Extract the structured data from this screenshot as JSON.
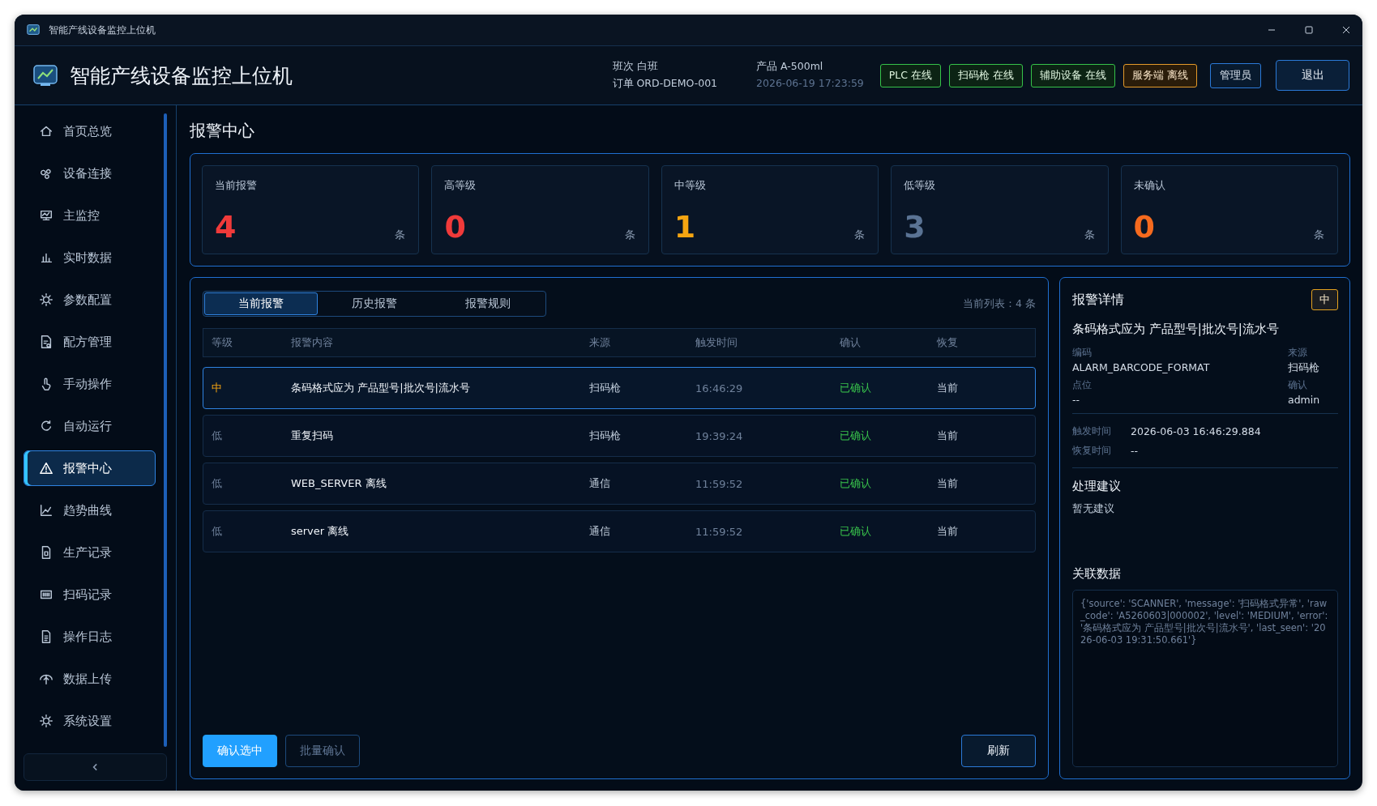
{
  "window": {
    "title": "智能产线设备监控上位机"
  },
  "header": {
    "title": "智能产线设备监控上位机",
    "info": [
      {
        "label": "班次",
        "value": "白班"
      },
      {
        "label": "订单",
        "value": "ORD-DEMO-001"
      },
      {
        "label": "产品",
        "value": "A-500ml"
      },
      {
        "value": "2026-06-19 17:23:59"
      }
    ],
    "statuses": [
      {
        "label": "PLC 在线",
        "online": true
      },
      {
        "label": "扫码枪 在线",
        "online": true
      },
      {
        "label": "辅助设备 在线",
        "online": true
      },
      {
        "label": "服务端 离线",
        "online": false
      }
    ],
    "user": "管理员",
    "logout": "退出"
  },
  "sidebar": {
    "items": [
      {
        "label": "首页总览",
        "selected": false
      },
      {
        "label": "设备连接",
        "selected": false
      },
      {
        "label": "主监控",
        "selected": false
      },
      {
        "label": "实时数据",
        "selected": false
      },
      {
        "label": "参数配置",
        "selected": false
      },
      {
        "label": "配方管理",
        "selected": false
      },
      {
        "label": "手动操作",
        "selected": false
      },
      {
        "label": "自动运行",
        "selected": false
      },
      {
        "label": "报警中心",
        "selected": true
      },
      {
        "label": "趋势曲线",
        "selected": false
      },
      {
        "label": "生产记录",
        "selected": false
      },
      {
        "label": "扫码记录",
        "selected": false
      },
      {
        "label": "操作日志",
        "selected": false
      },
      {
        "label": "数据上传",
        "selected": false
      },
      {
        "label": "系统设置",
        "selected": false
      }
    ]
  },
  "page_title": "报警中心",
  "stats": [
    {
      "label": "当前报警",
      "value": "4",
      "unit": "条",
      "color": "#f03a3a"
    },
    {
      "label": "高等级",
      "value": "0",
      "unit": "条",
      "color": "#f03a3a"
    },
    {
      "label": "中等级",
      "value": "1",
      "unit": "条",
      "color": "#f5a511"
    },
    {
      "label": "低等级",
      "value": "3",
      "unit": "条",
      "color": "#5a7394"
    },
    {
      "label": "未确认",
      "value": "0",
      "unit": "条",
      "color": "#f56a1e"
    }
  ],
  "tabs": [
    {
      "label": "当前报警",
      "selected": true
    },
    {
      "label": "历史报警",
      "selected": false
    },
    {
      "label": "报警规则",
      "selected": false
    }
  ],
  "list_count": "当前列表：4 条",
  "table": {
    "columns": [
      "等级",
      "报警内容",
      "来源",
      "触发时间",
      "确认",
      "恢复"
    ],
    "rows": [
      {
        "level": "中",
        "kind": "medium",
        "message": "条码格式应为 产品型号|批次号|流水号",
        "source": "扫码枪",
        "time": "16:46:29",
        "confirm": "已确认",
        "confirmed": true,
        "recover": "当前",
        "selected": true
      },
      {
        "level": "低",
        "kind": "low",
        "message": "重复扫码",
        "source": "扫码枪",
        "time": "19:39:24",
        "confirm": "已确认",
        "confirmed": true,
        "recover": "当前",
        "selected": false
      },
      {
        "level": "低",
        "kind": "low",
        "message": "WEB_SERVER 离线",
        "source": "通信",
        "time": "11:59:52",
        "confirm": "已确认",
        "confirmed": true,
        "recover": "当前",
        "selected": false
      },
      {
        "level": "低",
        "kind": "low",
        "message": "server 离线",
        "source": "通信",
        "time": "11:59:52",
        "confirm": "已确认",
        "confirmed": true,
        "recover": "当前",
        "selected": false
      }
    ]
  },
  "actions": [
    {
      "label": "确认选中",
      "kind": "primary",
      "disabled": false
    },
    {
      "label": "批量确认",
      "kind": "secondary",
      "disabled": true
    }
  ],
  "refresh": "刷新",
  "detail": {
    "title": "报警详情",
    "badge": "中",
    "message": "条码格式应为 产品型号|批次号|流水号",
    "fields": [
      {
        "label": "编码",
        "value": "ALARM_BARCODE_FORMAT"
      },
      {
        "label": "来源",
        "value": "扫码枪"
      },
      {
        "label": "点位",
        "value": "--"
      },
      {
        "label": "确认",
        "value": "admin"
      }
    ],
    "times": [
      {
        "label": "触发时间",
        "value": "2026-06-03 16:46:29.884"
      },
      {
        "label": "恢复时间",
        "value": "--"
      }
    ],
    "suggestion_title": "处理建议",
    "suggestion": "暂无建议",
    "related_title": "关联数据",
    "related": "{'source': 'SCANNER', 'message': '扫码格式异常', 'raw_code': 'A5260603|000002', 'level': 'MEDIUM', 'error': '条码格式应为 产品型号|批次号|流水号', 'last_seen': '2026-06-03 19:31:50.661'}"
  }
}
